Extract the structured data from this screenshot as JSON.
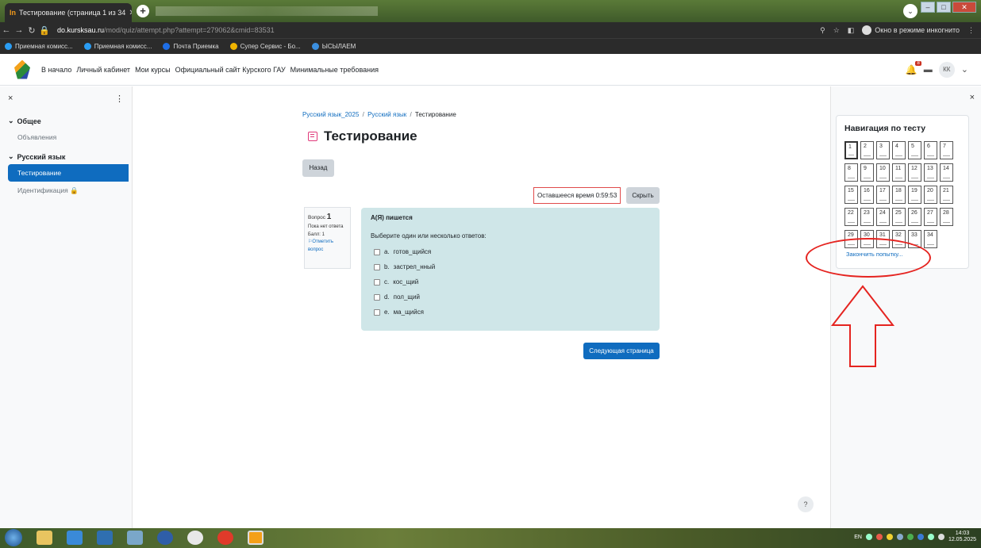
{
  "browser": {
    "tab_title": "Тестирование (страница 1 из 34",
    "tab_favicon": "ln",
    "url_host": "do.kursksau.ru",
    "url_path": "/mod/quiz/attempt.php?attempt=279062&cmid=83531",
    "incognito_label": "Окно в режиме инкогнито",
    "bookmarks": [
      {
        "label": "Приемная комисс...",
        "color": "#2a9df4"
      },
      {
        "label": "Приемная комисс...",
        "color": "#2a9df4"
      },
      {
        "label": "Почта Приемка",
        "color": "#1e6ee6"
      },
      {
        "label": "Супер Сервис - Бо...",
        "color": "#f0b400"
      },
      {
        "label": "ЫСЫЛАЕМ",
        "color": "#3b8fe0"
      }
    ]
  },
  "header": {
    "nav": [
      "В начало",
      "Личный кабинет",
      "Мои курсы",
      "Официальный сайт Курского ГАУ",
      "Минимальные требования"
    ],
    "notif_count": "8",
    "user_initials": "КК"
  },
  "drawer": {
    "close": "×",
    "more": "⋮",
    "sections": [
      {
        "title": "Общее",
        "items": [
          {
            "label": "Объявления",
            "active": false
          }
        ]
      },
      {
        "title": "Русский язык",
        "items": [
          {
            "label": "Тестирование",
            "active": true
          },
          {
            "label": "Идентификация",
            "active": false,
            "locked": true
          }
        ]
      }
    ]
  },
  "main": {
    "breadcrumb": [
      "Русский язык_2025",
      "Русский язык",
      "Тестирование"
    ],
    "page_title": "Тестирование",
    "back_label": "Назад",
    "timer_text": "Оставшееся время 0:59:53",
    "hide_label": "Скрыть",
    "question_info": {
      "label": "Вопрос",
      "number": "1",
      "status": "Пока нет ответа",
      "points": "Балл: 1",
      "flag": "Отметить вопрос"
    },
    "question": {
      "text": "А(Я) пишется",
      "prompt": "Выберите один или несколько ответов:",
      "options": [
        {
          "letter": "a.",
          "text": "готов_щийся"
        },
        {
          "letter": "b.",
          "text": "застрел_нный"
        },
        {
          "letter": "c.",
          "text": "кос_щий"
        },
        {
          "letter": "d.",
          "text": "пол_щий"
        },
        {
          "letter": "e.",
          "text": "ма_щийся"
        }
      ]
    },
    "next_label": "Следующая страница",
    "help": "?"
  },
  "quiz_nav": {
    "close": "×",
    "title": "Навигация по тесту",
    "questions": [
      "1",
      "2",
      "3",
      "4",
      "5",
      "6",
      "7",
      "8",
      "9",
      "10",
      "11",
      "12",
      "13",
      "14",
      "15",
      "16",
      "17",
      "18",
      "19",
      "20",
      "21",
      "22",
      "23",
      "24",
      "25",
      "26",
      "27",
      "28",
      "29",
      "30",
      "31",
      "32",
      "33",
      "34"
    ],
    "current": "1",
    "finish_label": "Закончить попытку..."
  },
  "taskbar": {
    "lang": "EN",
    "time": "14:03",
    "date": "12.05.2025"
  },
  "colors": {
    "accent": "#0f6cbf",
    "annotation": "#e52420",
    "question_bg": "#cfe6e8"
  }
}
